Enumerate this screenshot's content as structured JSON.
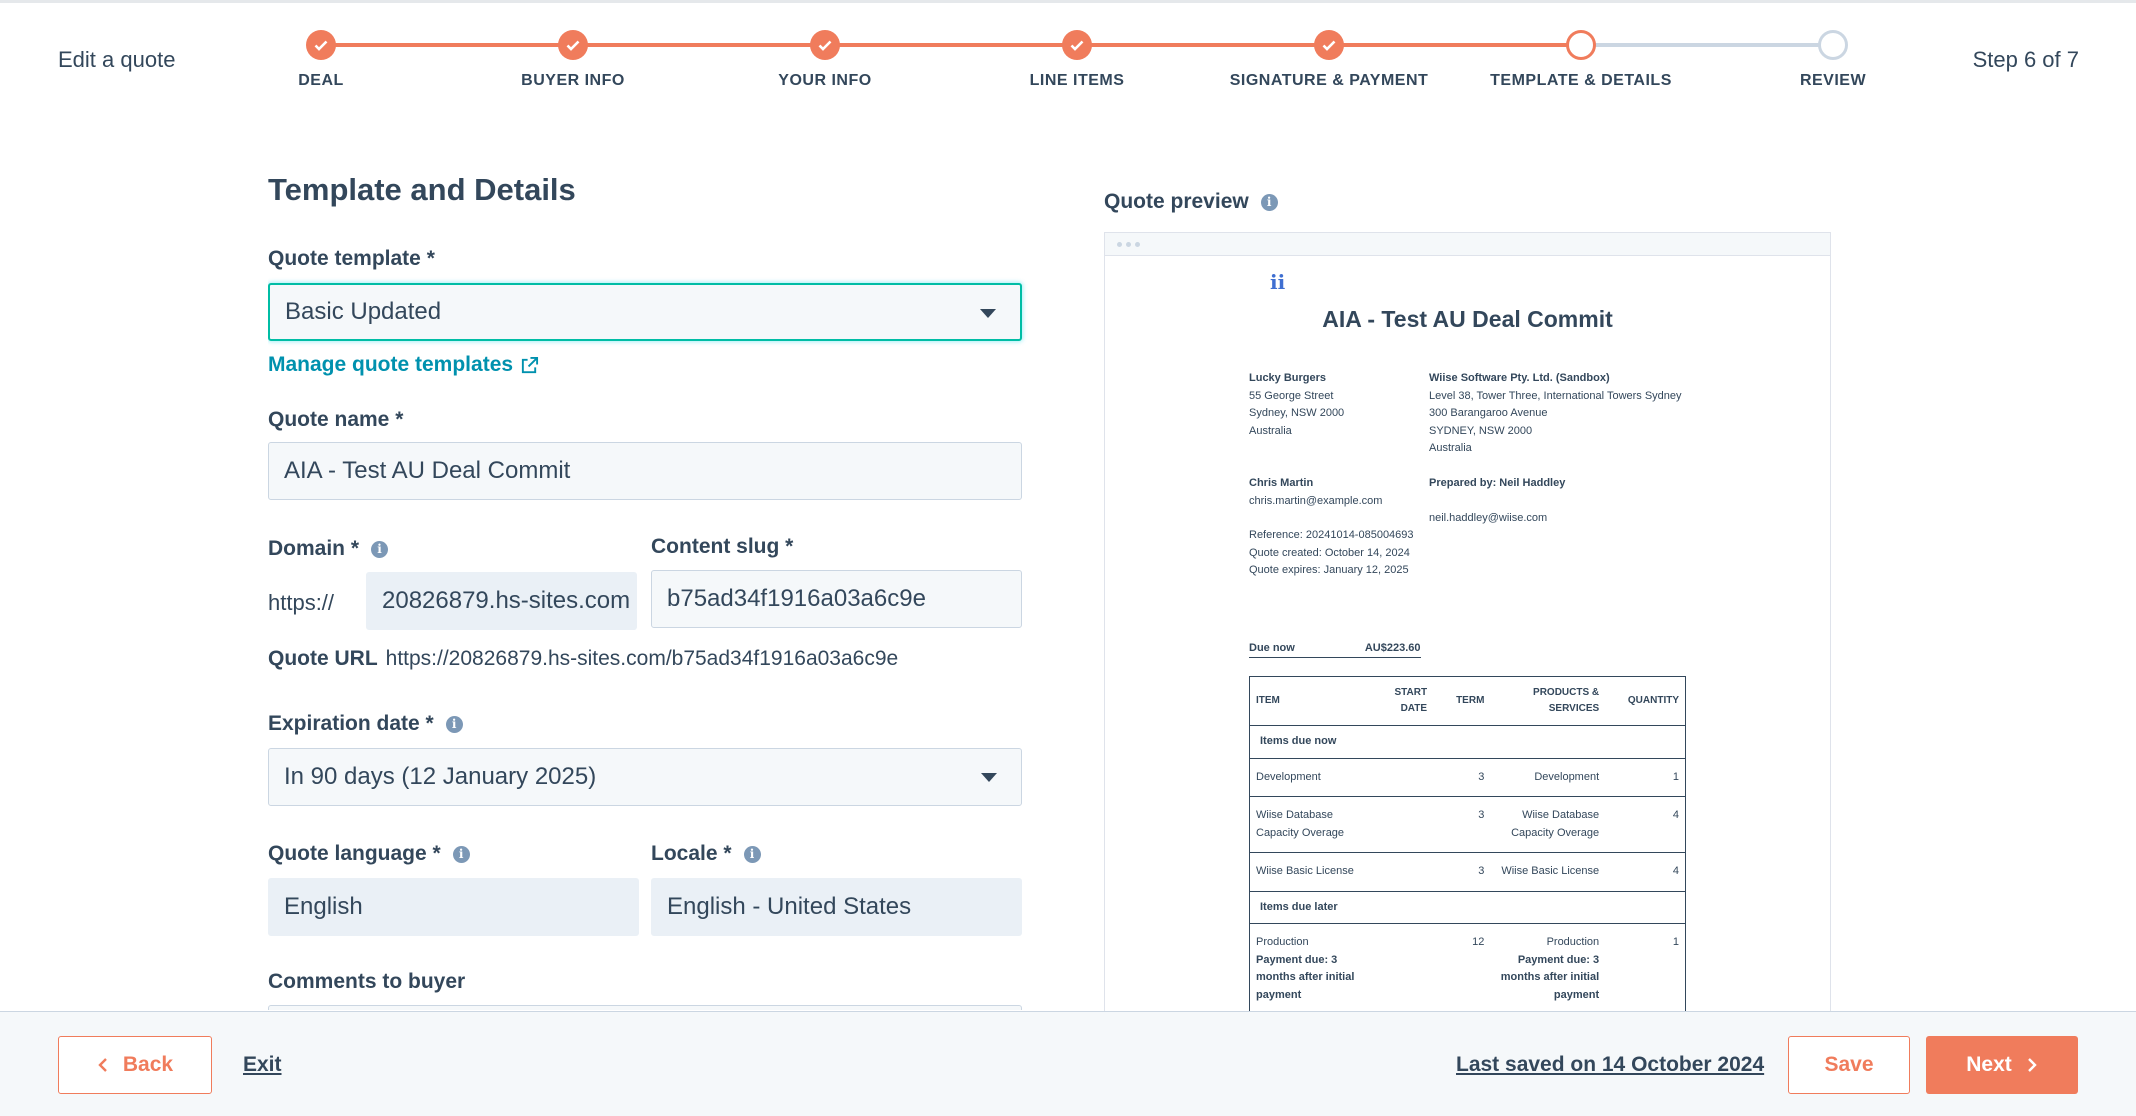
{
  "header": {
    "title": "Edit a quote",
    "step_count": "Step 6 of 7",
    "steps": [
      {
        "label": "DEAL",
        "status": "done"
      },
      {
        "label": "BUYER INFO",
        "status": "done"
      },
      {
        "label": "YOUR INFO",
        "status": "done"
      },
      {
        "label": "LINE ITEMS",
        "status": "done"
      },
      {
        "label": "SIGNATURE & PAYMENT",
        "status": "done"
      },
      {
        "label": "TEMPLATE & DETAILS",
        "status": "current"
      },
      {
        "label": "REVIEW",
        "status": "todo"
      }
    ]
  },
  "form": {
    "heading": "Template and Details",
    "template_label": "Quote template *",
    "template_value": "Basic Updated",
    "manage_link": "Manage quote templates",
    "name_label": "Quote name *",
    "name_value": "AIA - Test AU Deal Commit",
    "domain_label": "Domain *",
    "domain_prefix": "https://",
    "domain_value": "20826879.hs-sites.com",
    "slug_label": "Content slug *",
    "slug_value": "b75ad34f1916a03a6c9e",
    "url_label": "Quote URL",
    "url_value": "https://20826879.hs-sites.com/b75ad34f1916a03a6c9e",
    "expiration_label": "Expiration date *",
    "expiration_value": "In 90 days (12 January 2025)",
    "language_label": "Quote language *",
    "language_value": "English",
    "locale_label": "Locale *",
    "locale_value": "English - United States",
    "comments_label": "Comments to buyer"
  },
  "preview": {
    "label": "Quote preview",
    "logo": "ii",
    "title": "AIA - Test AU Deal Commit",
    "buyer": {
      "company": "Lucky Burgers",
      "address1": "55 George Street",
      "address2": "Sydney, NSW 2000",
      "country": "Australia",
      "contact_name": "Chris Martin",
      "contact_email": "chris.martin@example.com",
      "reference": "Reference: 20241014-085004693",
      "created": "Quote created: October 14, 2024",
      "expires": "Quote expires: January 12, 2025"
    },
    "seller": {
      "company": "Wiise Software Pty. Ltd. (Sandbox)",
      "address1": "Level 38, Tower Three, International Towers Sydney",
      "address2": "300 Barangaroo Avenue",
      "address3": "SYDNEY, NSW 2000",
      "country": "Australia",
      "prepared_by": "Prepared by: Neil Haddley",
      "email": "neil.haddley@wiise.com"
    },
    "due_label": "Due now",
    "due_value": "AU$223.60",
    "table": {
      "headers": [
        "ITEM",
        "START DATE",
        "TERM",
        "PRODUCTS & SERVICES",
        "QUANTITY"
      ],
      "group_now": "Items due now",
      "group_later": "Items due later",
      "rows_now": [
        {
          "item": "Development",
          "term": "3",
          "product": "Development",
          "qty": "1"
        },
        {
          "item": "Wiise Database Capacity Overage",
          "term": "3",
          "product": "Wiise Database Capacity Overage",
          "qty": "4"
        },
        {
          "item": "Wiise Basic License",
          "term": "3",
          "product": "Wiise Basic License",
          "qty": "4"
        }
      ],
      "rows_later": [
        {
          "item": "Production",
          "item_note": "Payment due: 3 months after initial payment",
          "term": "12",
          "product": "Production",
          "product_note": "Payment due: 3 months after initial payment",
          "qty": "1"
        }
      ]
    }
  },
  "footer": {
    "back": "Back",
    "exit": "Exit",
    "last_saved": "Last saved on 14 October 2024",
    "save": "Save",
    "next": "Next"
  },
  "colors": {
    "accent": "#f07c5c",
    "text": "#33475b",
    "link": "#0091ae",
    "focus": "#00bda5"
  }
}
